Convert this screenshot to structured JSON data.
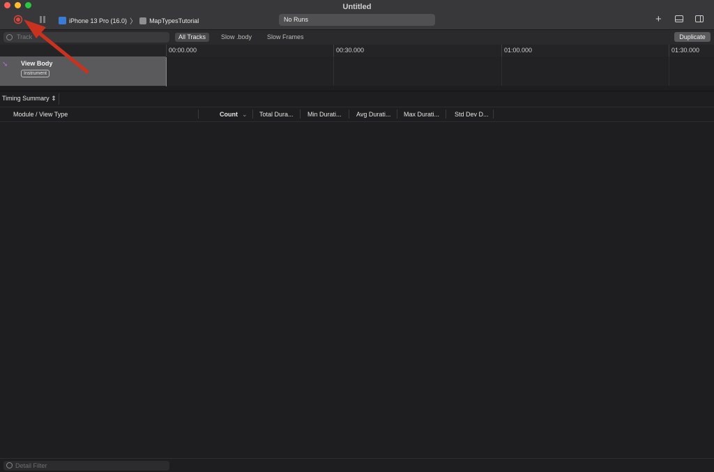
{
  "window": {
    "title": "Untitled"
  },
  "toolbar": {
    "device": "iPhone 13 Pro (16.0)",
    "target_app": "MapTypesTutorial",
    "status": "No Runs"
  },
  "filterbar": {
    "track_filter_placeholder": "Track",
    "segments": [
      "All Tracks",
      "Slow .body",
      "Slow Frames"
    ],
    "duplicate_label": "Duplicate"
  },
  "timeline": {
    "ticks": [
      "00:00.000",
      "00:30.000",
      "01:00.000",
      "01:30.000"
    ]
  },
  "track": {
    "title": "View Body",
    "badge": "Instrument"
  },
  "detail": {
    "mode": "Timing Summary",
    "columns": [
      "Module / View Type",
      "Count",
      "Total Dura...",
      "Min Durati...",
      "Avg Durati...",
      "Max Durati...",
      "Std Dev D..."
    ],
    "filter_placeholder": "Detail Filter"
  },
  "colors": {
    "annotation_arrow": "#c8321f",
    "record": "#e0443a",
    "track_icon": "#b36bd6"
  },
  "icons": [
    "record-icon",
    "pause-icon",
    "device-icon",
    "app-icon",
    "chevron-right-icon",
    "plus-icon",
    "bottom-panel-icon",
    "side-panel-icon",
    "filter-icon",
    "swiftui-icon",
    "sort-chevron-icon",
    "updown-chevron-icon"
  ]
}
